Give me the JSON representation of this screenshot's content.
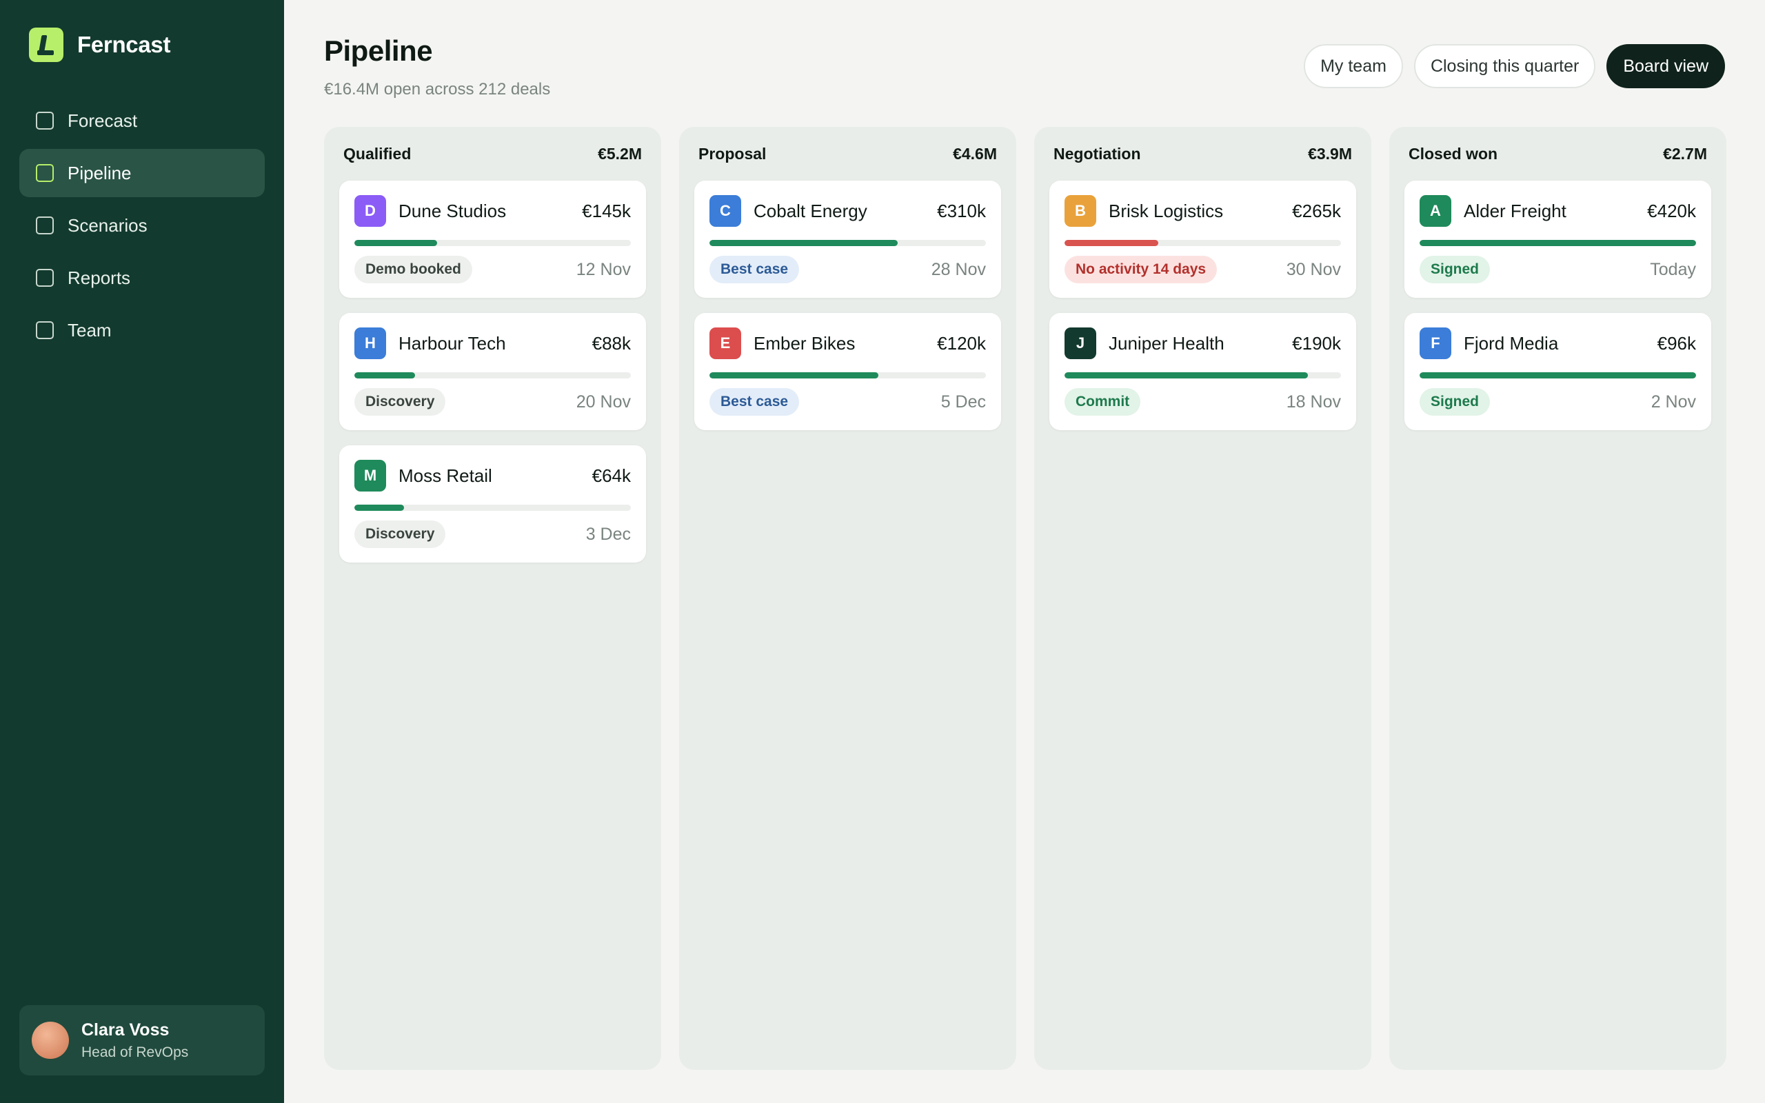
{
  "app": {
    "name": "Ferncast"
  },
  "nav": {
    "items": [
      {
        "label": "Forecast"
      },
      {
        "label": "Pipeline"
      },
      {
        "label": "Scenarios"
      },
      {
        "label": "Reports"
      },
      {
        "label": "Team"
      }
    ],
    "active": "Pipeline"
  },
  "user": {
    "name": "Clara Voss",
    "role": "Head of RevOps"
  },
  "page": {
    "title": "Pipeline",
    "subtitle": "€16.4M open across 212 deals"
  },
  "filters": {
    "my_team": "My team",
    "closing": "Closing this quarter",
    "board_view": "Board view"
  },
  "colors": {
    "sidebar": "#133a2e",
    "accent": "#b7ef6b",
    "progress_green": "#1f8a5b",
    "progress_red": "#d9534f"
  },
  "columns": [
    {
      "name": "Qualified",
      "total": "€5.2M",
      "deals": [
        {
          "initial": "D",
          "name": "Dune Studios",
          "amount": "€145k",
          "progress": 0.3,
          "badge": "Demo booked",
          "badge_style": "neutral",
          "date": "12 Nov",
          "avatar_color": "#8b5cf6"
        },
        {
          "initial": "H",
          "name": "Harbour Tech",
          "amount": "€88k",
          "progress": 0.22,
          "badge": "Discovery",
          "badge_style": "neutral",
          "date": "20 Nov",
          "avatar_color": "#3b7dd8"
        },
        {
          "initial": "M",
          "name": "Moss Retail",
          "amount": "€64k",
          "progress": 0.18,
          "badge": "Discovery",
          "badge_style": "neutral",
          "date": "3 Dec",
          "avatar_color": "#1f8a5b"
        }
      ]
    },
    {
      "name": "Proposal",
      "total": "€4.6M",
      "deals": [
        {
          "initial": "C",
          "name": "Cobalt Energy",
          "amount": "€310k",
          "progress": 0.68,
          "badge": "Best case",
          "badge_style": "blue",
          "date": "28 Nov",
          "avatar_color": "#3b7dd8"
        },
        {
          "initial": "E",
          "name": "Ember Bikes",
          "amount": "€120k",
          "progress": 0.61,
          "badge": "Best case",
          "badge_style": "blue",
          "date": "5 Dec",
          "avatar_color": "#dc4d4d"
        }
      ]
    },
    {
      "name": "Negotiation",
      "total": "€3.9M",
      "deals": [
        {
          "initial": "B",
          "name": "Brisk Logistics",
          "amount": "€265k",
          "progress": 0.34,
          "badge": "No activity 14 days",
          "badge_style": "red",
          "date": "30 Nov",
          "avatar_color": "#e9a23b",
          "bar_color": "red"
        },
        {
          "initial": "J",
          "name": "Juniper Health",
          "amount": "€190k",
          "progress": 0.88,
          "badge": "Commit",
          "badge_style": "green",
          "date": "18 Nov",
          "avatar_color": "#133a2e"
        }
      ]
    },
    {
      "name": "Closed won",
      "total": "€2.7M",
      "deals": [
        {
          "initial": "A",
          "name": "Alder Freight",
          "amount": "€420k",
          "progress": 1.0,
          "badge": "Signed",
          "badge_style": "green",
          "date": "Today",
          "avatar_color": "#1f8a5b"
        },
        {
          "initial": "F",
          "name": "Fjord Media",
          "amount": "€96k",
          "progress": 1.0,
          "badge": "Signed",
          "badge_style": "green",
          "date": "2 Nov",
          "avatar_color": "#3b7dd8"
        }
      ]
    }
  ]
}
